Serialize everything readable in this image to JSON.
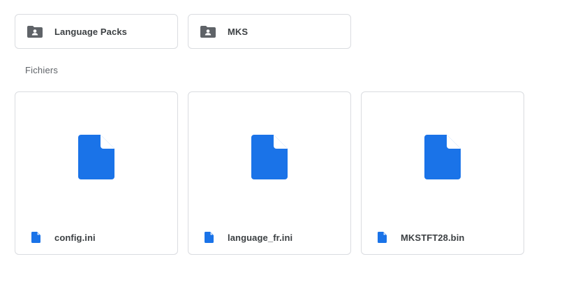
{
  "colors": {
    "file_icon": "#1a73e8",
    "folder_icon": "#5f6368"
  },
  "folders": [
    {
      "label": "Language Packs",
      "icon": "shared-folder-icon"
    },
    {
      "label": "MKS",
      "icon": "shared-folder-icon"
    }
  ],
  "files_section": {
    "title": "Fichiers"
  },
  "files": [
    {
      "name": "config.ini",
      "icon": "file-icon"
    },
    {
      "name": "language_fr.ini",
      "icon": "file-icon"
    },
    {
      "name": "MKSTFT28.bin",
      "icon": "file-icon"
    }
  ]
}
